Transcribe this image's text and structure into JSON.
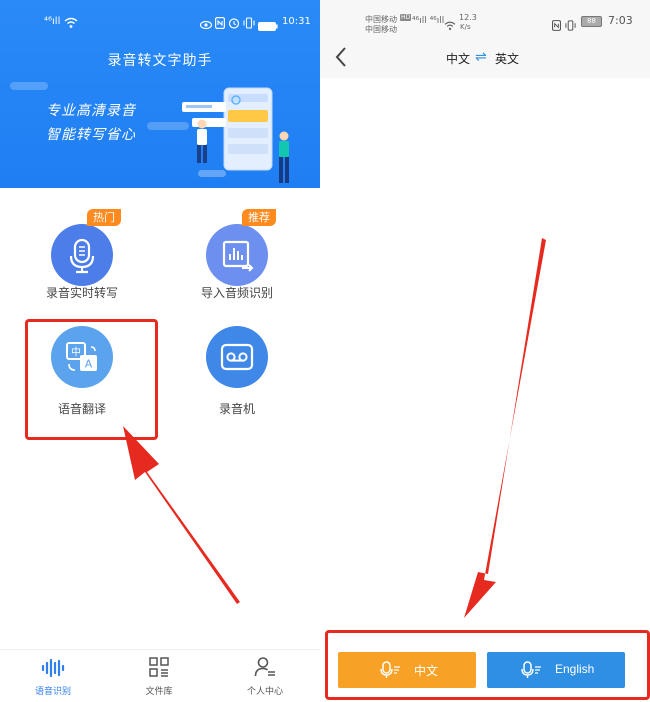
{
  "left": {
    "status_bar": {
      "signal": "⁴⁶ıll",
      "time": "10:31"
    },
    "banner": {
      "app_title": "录音转文字助手",
      "slogan_line1": "专业高清录音",
      "slogan_line2": "智能转写省心"
    },
    "features": [
      {
        "label": "录音实时转写",
        "badge": "热门",
        "icon": "microphone-icon"
      },
      {
        "label": "导入音频识别",
        "badge": "推荐",
        "icon": "audio-import-icon"
      },
      {
        "label": "语音翻译",
        "badge": "",
        "icon": "translate-icon"
      },
      {
        "label": "录音机",
        "badge": "",
        "icon": "recorder-icon"
      }
    ],
    "nav": [
      {
        "label": "语音识别",
        "icon": "waveform-icon",
        "active": true
      },
      {
        "label": "文件库",
        "icon": "grid-icon",
        "active": false
      },
      {
        "label": "个人中心",
        "icon": "person-icon",
        "active": false
      }
    ]
  },
  "right": {
    "status_bar": {
      "carrier1": "中国移动",
      "carrier2": "中国移动",
      "hd": "HD",
      "speed": "12.3",
      "speed_unit": "K/s",
      "battery": "88",
      "time": "7:03"
    },
    "header": {
      "lang_from": "中文",
      "swap": "⇌",
      "lang_to": "英文"
    },
    "buttons": [
      {
        "label": "中文",
        "color": "#f7a226"
      },
      {
        "label": "English",
        "color": "#2f8fe3"
      }
    ]
  },
  "colors": {
    "primary": "#1f7ef3",
    "accent": "#ff8a1e",
    "highlight": "#e62a20"
  }
}
